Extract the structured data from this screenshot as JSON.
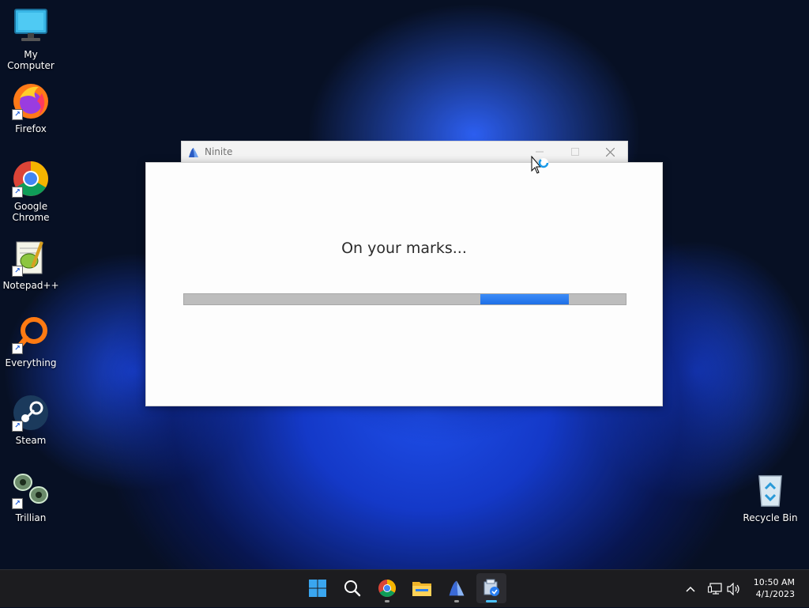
{
  "desktop": {
    "icons": [
      {
        "label": "My Computer"
      },
      {
        "label": "Firefox"
      },
      {
        "label": "Google\nChrome"
      },
      {
        "label": "Notepad++"
      },
      {
        "label": "Everything"
      },
      {
        "label": "Steam"
      },
      {
        "label": "Trillian"
      },
      {
        "label": "Recycle Bin"
      }
    ]
  },
  "window": {
    "title": "Ninite",
    "status": "On your marks...",
    "progress_fill_fraction": [
      0.67,
      0.87
    ],
    "accent_color": "#2a7ef0"
  },
  "taskbar": {
    "clock": {
      "time": "10:50 AM",
      "date": "4/1/2023"
    }
  }
}
